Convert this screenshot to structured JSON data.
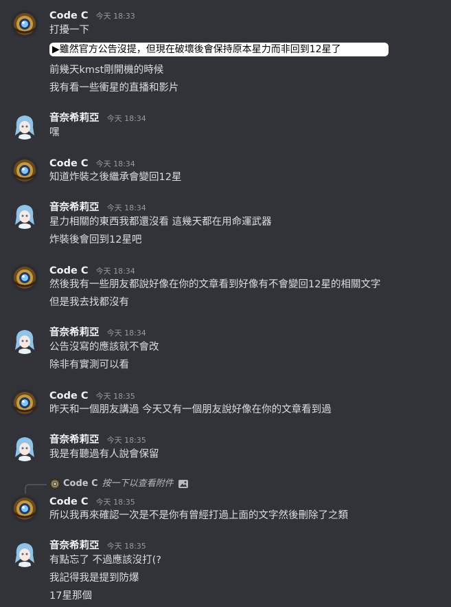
{
  "users": {
    "codec": {
      "name": "Code C"
    },
    "otori": {
      "name": "音奈希莉亞"
    }
  },
  "messages": [
    {
      "author": "Code C",
      "time": "今天 18:33",
      "lines": [
        "打擾一下"
      ],
      "quote": "▶雖然官方公告沒提，但現在破壞後會保持原本星力而非回到12星了",
      "after_quote": [
        "前幾天kmst剛開機的時候",
        "我有看一些衝星的直播和影片"
      ]
    },
    {
      "author": "音奈希莉亞",
      "time": "今天 18:34",
      "lines": [
        "嘿"
      ]
    },
    {
      "author": "Code C",
      "time": "今天 18:34",
      "lines": [
        "知道炸裝之後繼承會變回12星"
      ]
    },
    {
      "author": "音奈希莉亞",
      "time": "今天 18:34",
      "lines": [
        "星力相關的東西我都還沒看  這幾天都在用命運武器",
        "炸裝後會回到12星吧"
      ]
    },
    {
      "author": "Code C",
      "time": "今天 18:34",
      "lines": [
        "然後我有一些朋友都說好像在你的文章看到好像有不會變回12星的相關文字",
        "但是我去找都沒有"
      ]
    },
    {
      "author": "音奈希莉亞",
      "time": "今天 18:34",
      "lines": [
        "公告沒寫的應該就不會改",
        "除非有實測可以看"
      ]
    },
    {
      "author": "Code C",
      "time": "今天 18:35",
      "lines": [
        "昨天和一個朋友講過 今天又有一個朋友說好像在你的文章看到過"
      ]
    },
    {
      "author": "音奈希莉亞",
      "time": "今天 18:35",
      "lines": [
        "我是有聽過有人說會保留"
      ]
    },
    {
      "author": "Code C",
      "time": "今天 18:35",
      "reply": {
        "name": "Code C",
        "text": "按一下以查看附件",
        "icon": "image-icon"
      },
      "lines": [
        "所以我再來確認一次是不是你有曾經打過上面的文字然後刪除了之類"
      ]
    },
    {
      "author": "音奈希莉亞",
      "time": "今天 18:35",
      "lines": [
        "有點忘了 不過應該沒打(?",
        "我記得我是提到防爆",
        "17星那個"
      ]
    }
  ],
  "colors": {
    "background": "#313338",
    "text": "#dbdee1",
    "username": "#f2f3f5",
    "timestamp": "#949ba4",
    "quote_bg": "#ffffff"
  }
}
